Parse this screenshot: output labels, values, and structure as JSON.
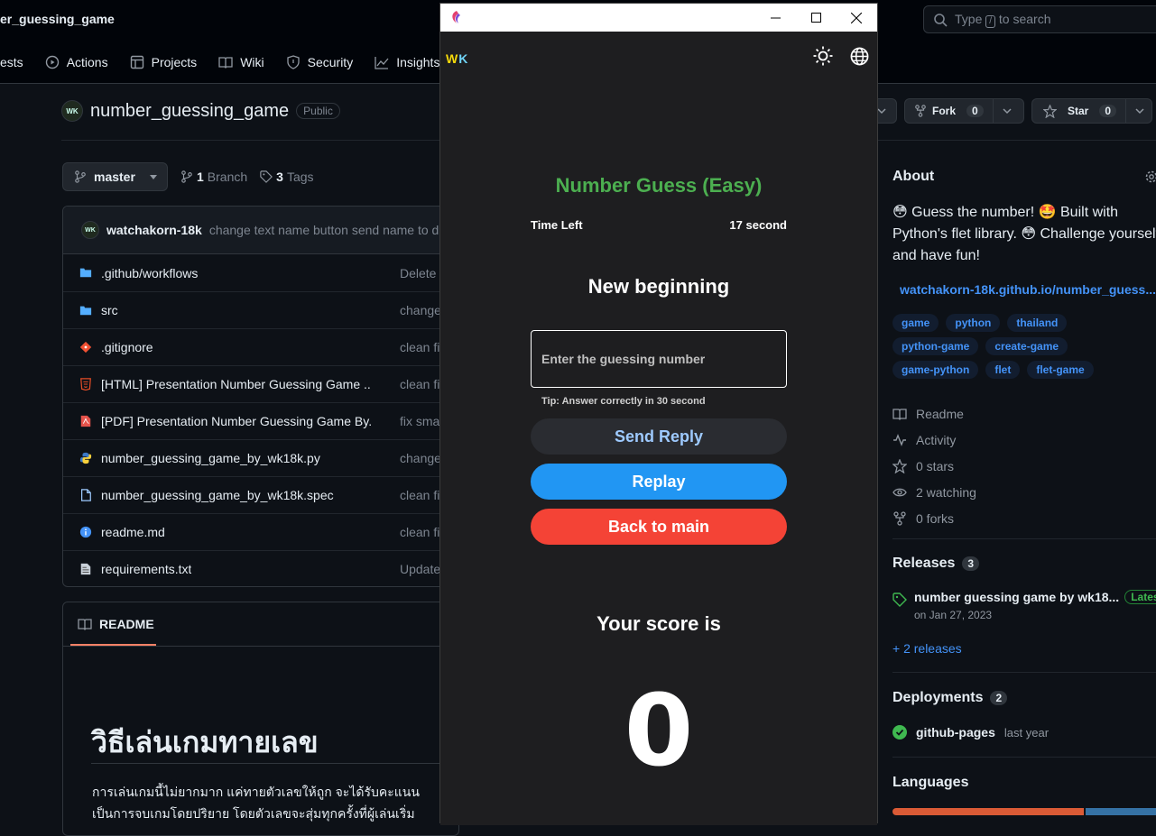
{
  "github": {
    "repo_crumb": "er_guessing_game",
    "search": {
      "pre": "Type",
      "key": "/",
      "post": "to search"
    },
    "nav": [
      {
        "label": "ests",
        "icon": "pull-request-icon"
      },
      {
        "label": "Actions",
        "icon": "play-circle-icon"
      },
      {
        "label": "Projects",
        "icon": "table-icon"
      },
      {
        "label": "Wiki",
        "icon": "book-icon"
      },
      {
        "label": "Security",
        "icon": "shield-icon"
      },
      {
        "label": "Insights",
        "icon": "graph-icon"
      }
    ],
    "repo": {
      "avatar": "WK",
      "name": "number_guessing_game",
      "visibility": "Public"
    },
    "fork": {
      "label": "Fork",
      "count": "0"
    },
    "star": {
      "label": "Star",
      "count": "0"
    },
    "branch": {
      "name": "master",
      "branches_count": "1",
      "branches_label": "Branch",
      "tags_count": "3",
      "tags_label": "Tags"
    },
    "last_commit": {
      "avatar": "WK",
      "author": "watchakorn-18k",
      "message": "change text name button send name to db"
    },
    "files": [
      {
        "name": ".github/workflows",
        "commit": "Delete",
        "icon": "folder-icon"
      },
      {
        "name": "src",
        "commit": "change",
        "icon": "folder-icon"
      },
      {
        "name": ".gitignore",
        "commit": "clean fi",
        "icon": "git-icon"
      },
      {
        "name": "[HTML] Presentation Number Guessing Game ...",
        "commit": "clean fi",
        "icon": "html-file-icon"
      },
      {
        "name": "[PDF] Presentation Number Guessing Game By...",
        "commit": "fix smal",
        "icon": "pdf-file-icon"
      },
      {
        "name": "number_guessing_game_by_wk18k.py",
        "commit": "change",
        "icon": "python-file-icon"
      },
      {
        "name": "number_guessing_game_by_wk18k.spec",
        "commit": "clean fi",
        "icon": "file-icon"
      },
      {
        "name": "readme.md",
        "commit": "clean fi",
        "icon": "info-icon"
      },
      {
        "name": "requirements.txt",
        "commit": "Update",
        "icon": "text-file-icon"
      }
    ],
    "readme": {
      "tab": "README",
      "heading": "วิธีเล่นเกมทายเลข",
      "line1": "การเล่นเกมนี้ไม่ยากมาก แค่ทายตัวเลขให้ถูก จะได้รับคะแนน",
      "line2": "เป็นการจบเกมโดยปริยาย โดยตัวเลขจะสุ่มทุกครั้งที่ผู้เล่นเริ่ม"
    },
    "about": {
      "title": "About",
      "desc_line1": "😳 Guess the number!  🤩 Built with",
      "desc_line2": "Python's flet library.  😳 Challenge yourself",
      "desc_line3": "and have fun!",
      "link": "watchakorn-18k.github.io/number_guess...",
      "topics": [
        "game",
        "python",
        "thailand",
        "python-game",
        "create-game",
        "game-python",
        "flet",
        "flet-game"
      ],
      "stats": [
        {
          "label": "Readme",
          "icon": "book-icon"
        },
        {
          "label": "Activity",
          "icon": "pulse-icon"
        },
        {
          "label": "0 stars",
          "icon": "star-icon"
        },
        {
          "label": "2 watching",
          "icon": "eye-icon"
        },
        {
          "label": "0 forks",
          "icon": "fork-icon"
        }
      ]
    },
    "releases": {
      "title": "Releases",
      "count": "3",
      "latest_name": "number guessing game by wk18...",
      "latest_badge": "Latest",
      "latest_date": "on Jan 27, 2023",
      "more": "+ 2 releases"
    },
    "deployments": {
      "title": "Deployments",
      "count": "2",
      "env": "github-pages",
      "time": "last year"
    },
    "languages": {
      "title": "Languages"
    },
    "colors": {
      "lang_primary": "#da5b36",
      "lang_secondary": "#3572a5"
    }
  },
  "app": {
    "logo": "WK",
    "title": "Number Guess (Easy)",
    "time_label": "Time Left",
    "time_value": "17 second",
    "status": "New beginning",
    "input_placeholder": "Enter the guessing number",
    "tip": "Tip: Answer correctly in 30  second",
    "send_label": "Send Reply",
    "replay_label": "Replay",
    "back_label": "Back to main",
    "score_label": "Your score is",
    "score_value": "0",
    "colors": {
      "title": "#4caf50",
      "replay": "#2196f3",
      "back": "#f44336",
      "send_text": "#9ecaff"
    }
  }
}
